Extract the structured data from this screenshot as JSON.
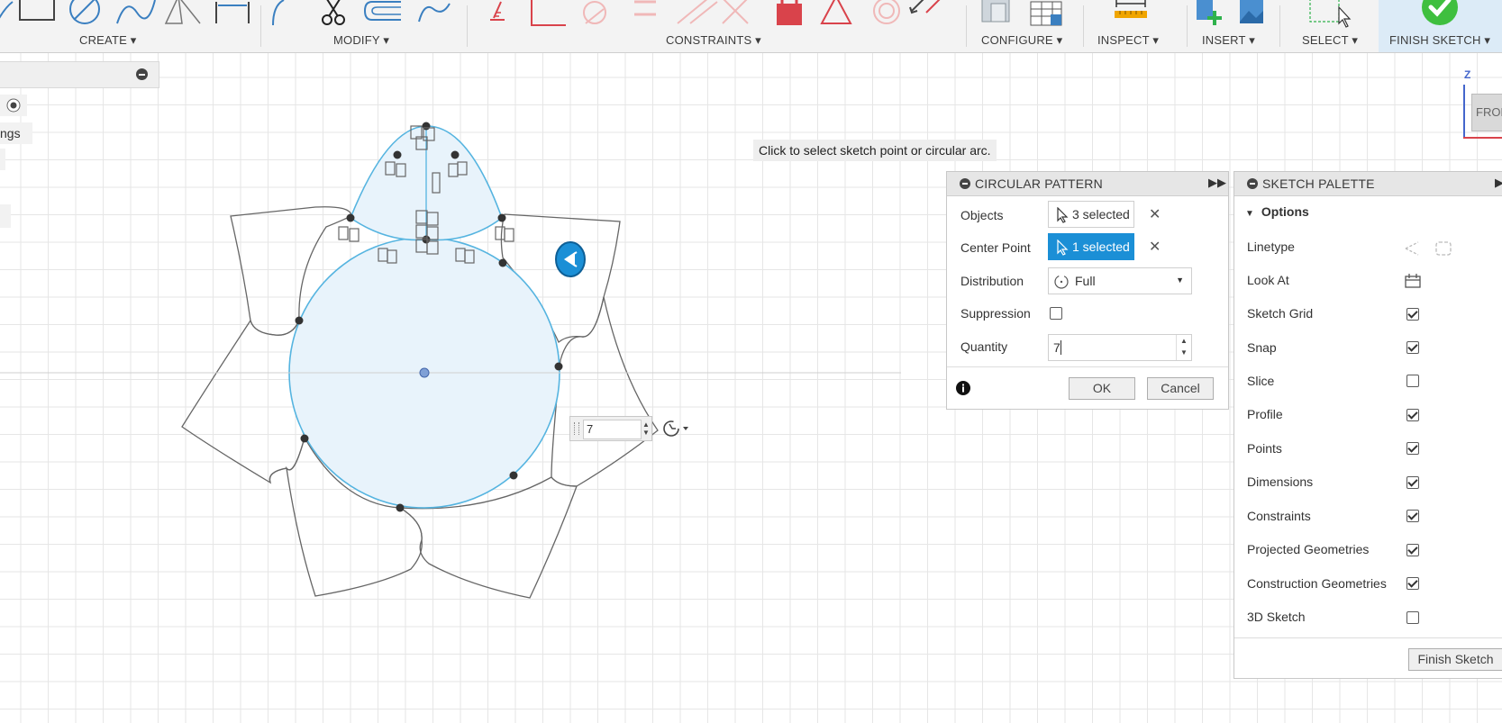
{
  "toolbar": {
    "groups": [
      {
        "label": "CREATE ▾"
      },
      {
        "label": "MODIFY ▾"
      },
      {
        "label": "CONSTRAINTS ▾"
      },
      {
        "label": "CONFIGURE ▾"
      },
      {
        "label": "INSPECT ▾"
      },
      {
        "label": "INSERT ▾"
      },
      {
        "label": "SELECT ▾"
      },
      {
        "label": "FINISH SKETCH ▾"
      }
    ]
  },
  "browser": {
    "row_settings": "ngs"
  },
  "canvas": {
    "tooltip": "Click to select sketch point or circular arc.",
    "inline_quantity": "7"
  },
  "viewcube": {
    "axis_label": "Z",
    "face_label": "FRONT"
  },
  "circular_pattern": {
    "title": "CIRCULAR PATTERN",
    "objects_label": "Objects",
    "objects_value": "3 selected",
    "center_label": "Center Point",
    "center_value": "1 selected",
    "distribution_label": "Distribution",
    "distribution_value": "Full",
    "suppression_label": "Suppression",
    "suppression_checked": false,
    "quantity_label": "Quantity",
    "quantity_value": "7",
    "ok_label": "OK",
    "cancel_label": "Cancel"
  },
  "sketch_palette": {
    "title": "SKETCH PALETTE",
    "section": "Options",
    "rows": [
      {
        "label": "Linetype",
        "type": "icons"
      },
      {
        "label": "Look At",
        "type": "icon"
      },
      {
        "label": "Sketch Grid",
        "type": "check",
        "checked": true
      },
      {
        "label": "Snap",
        "type": "check",
        "checked": true
      },
      {
        "label": "Slice",
        "type": "check",
        "checked": false
      },
      {
        "label": "Profile",
        "type": "check",
        "checked": true
      },
      {
        "label": "Points",
        "type": "check",
        "checked": true
      },
      {
        "label": "Dimensions",
        "type": "check",
        "checked": true
      },
      {
        "label": "Constraints",
        "type": "check",
        "checked": true
      },
      {
        "label": "Projected Geometries",
        "type": "check",
        "checked": true
      },
      {
        "label": "Construction Geometries",
        "type": "check",
        "checked": true
      },
      {
        "label": "3D Sketch",
        "type": "check",
        "checked": false
      }
    ],
    "finish_label": "Finish Sketch"
  },
  "colors": {
    "selection_blue": "#1b8fd6",
    "sketch_fill": "#e8f3fb",
    "sketch_stroke": "#55b4e0",
    "constraint_red": "#d9434b",
    "insert_green": "#2fb24c",
    "finish_green": "#3fbf3f"
  }
}
